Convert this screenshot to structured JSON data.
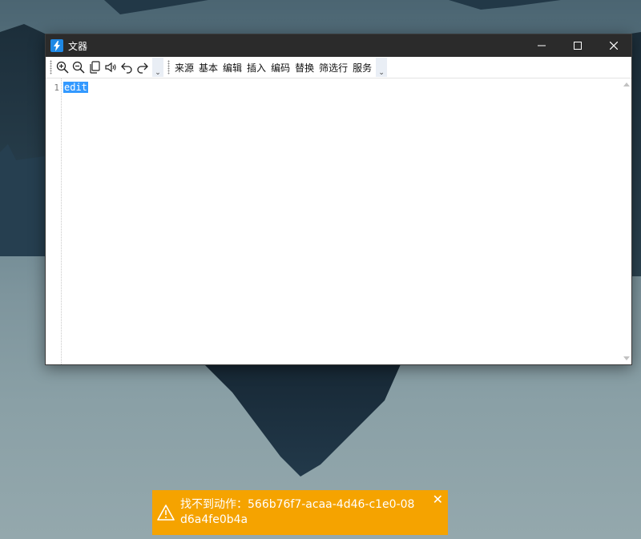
{
  "window": {
    "title": "文器",
    "controls": [
      "minimize-icon",
      "maximize-icon",
      "close-icon"
    ]
  },
  "toolbar": {
    "icons": [
      "zoom-in-icon",
      "zoom-out-icon",
      "copy-icon",
      "speaker-icon",
      "undo-icon",
      "redo-icon"
    ],
    "overflow_glyph": "⌄",
    "menu": [
      "来源",
      "基本",
      "编辑",
      "插入",
      "编码",
      "替换",
      "筛选行",
      "服务"
    ]
  },
  "editor": {
    "lines": [
      {
        "number": "1",
        "text": "edit",
        "selected": true
      }
    ]
  },
  "toast": {
    "message": "找不到动作：566b76f7-acaa-4d46-c1e0-08d6a4fe0b4a",
    "close_glyph": "✕",
    "color": "#f5a300",
    "icon": "warning-icon"
  }
}
